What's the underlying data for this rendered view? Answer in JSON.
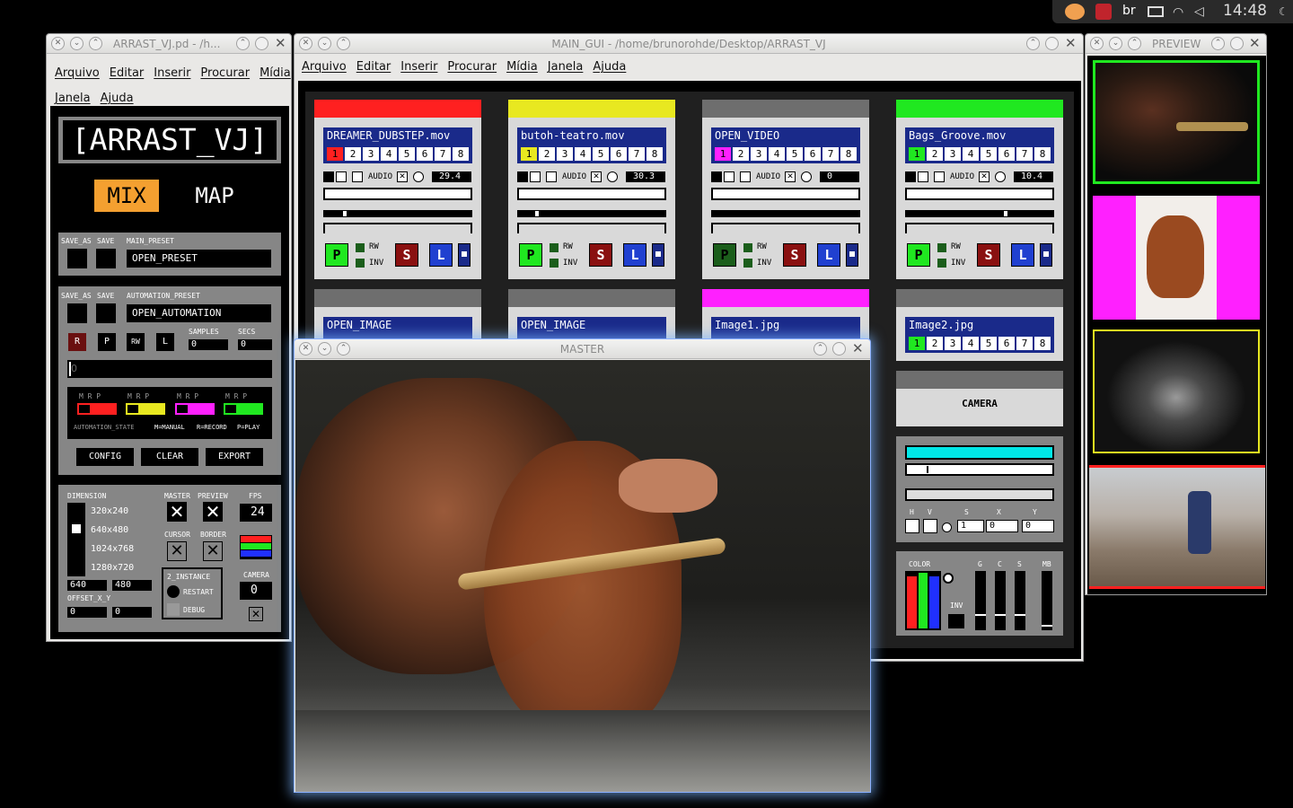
{
  "systray": {
    "lang": "br",
    "time": "14:48"
  },
  "left_window": {
    "title": "ARRAST_VJ.pd  - /h...",
    "menu": [
      "Arquivo",
      "Editar",
      "Inserir",
      "Procurar",
      "Mídia",
      "Janela",
      "Ajuda"
    ],
    "app_title": "[ARRAST_VJ]",
    "mix_label": "MIX",
    "map_label": "MAP",
    "save_as": "SAVE_AS",
    "save": "SAVE",
    "main_preset_label": "MAIN_PRESET",
    "main_preset_value": "OPEN_PRESET",
    "automation_preset_label": "AUTOMATION_PRESET",
    "automation_preset_value": "OPEN_AUTOMATION",
    "rec_buttons": [
      "R",
      "P",
      "RW",
      "L"
    ],
    "samples_label": "SAMPLES",
    "samples_value": "0",
    "secs_label": "SECS",
    "secs_value": "0",
    "position_value": "0",
    "mrp": "M R P",
    "automation_state": "AUTOMATION_STATE",
    "manual": "M=MANUAL",
    "record": "R=RECORD",
    "play": "P=PLAY",
    "config": "CONFIG",
    "clear": "CLEAR",
    "export": "EXPORT",
    "dimension_label": "DIMENSION",
    "dimensions": [
      "320x240",
      "640x480",
      "1024x768",
      "1280x720"
    ],
    "width_value": "640",
    "height_value": "480",
    "offset_label": "OFFSET_X_Y",
    "offset_x": "0",
    "offset_y": "0",
    "master_label": "MASTER",
    "preview_label": "PREVIEW",
    "fps_label": "FPS",
    "fps_value": "24",
    "cursor_label": "CURSOR",
    "border_label": "BORDER",
    "instance_label": "2_INSTANCE",
    "restart_label": "RESTART",
    "debug_label": "DEBUG",
    "camera_label": "CAMERA",
    "camera_value": "0"
  },
  "main_window": {
    "title": "MAIN_GUI  - /home/brunorohde/Desktop/ARRAST_VJ",
    "menu": [
      "Arquivo",
      "Editar",
      "Inserir",
      "Procurar",
      "Mídia",
      "Janela",
      "Ajuda"
    ],
    "decks": [
      {
        "name": "DREAMER_DUBSTEP.mov",
        "color": "#ff2020",
        "value": "29.4"
      },
      {
        "name": "butoh-teatro.mov",
        "color": "#e8e820",
        "value": "30.3"
      },
      {
        "name": "OPEN_VIDEO",
        "color": "#6e6e6e",
        "value": "0"
      },
      {
        "name": "Bags_Groove.mov",
        "color": "#20e820",
        "value": "10.4"
      }
    ],
    "numbers": [
      "1",
      "2",
      "3",
      "4",
      "5",
      "6",
      "7",
      "8"
    ],
    "audio": "AUDIO",
    "rw": "RW",
    "inv": "INV",
    "btn_p": "P",
    "btn_s": "S",
    "btn_l": "L",
    "decks2": [
      {
        "name": "OPEN_IMAGE",
        "color": "#6e6e6e"
      },
      {
        "name": "OPEN_IMAGE",
        "color": "#6e6e6e"
      },
      {
        "name": "Image1.jpg",
        "color": "#ff20ff"
      },
      {
        "name": "Image2.jpg",
        "color": "#6e6e6e"
      }
    ],
    "camera": "CAMERA",
    "hvsxy": [
      "H",
      "V",
      "S",
      "X",
      "Y"
    ],
    "s_value": "1",
    "x_value": "0",
    "y_value": "0",
    "color_label": "COLOR",
    "inv_label": "INV",
    "gcsmb": [
      "G",
      "C",
      "S",
      "MB"
    ]
  },
  "preview_window": {
    "title": "PREVIEW"
  },
  "master_window": {
    "title": "MASTER"
  },
  "colors": {
    "red": "#ff2020",
    "yellow": "#e8e820",
    "magenta": "#ff20ff",
    "green": "#20e820",
    "cyan": "#00e8e8",
    "blue": "#1a2a8a",
    "orange": "#f4a030"
  }
}
